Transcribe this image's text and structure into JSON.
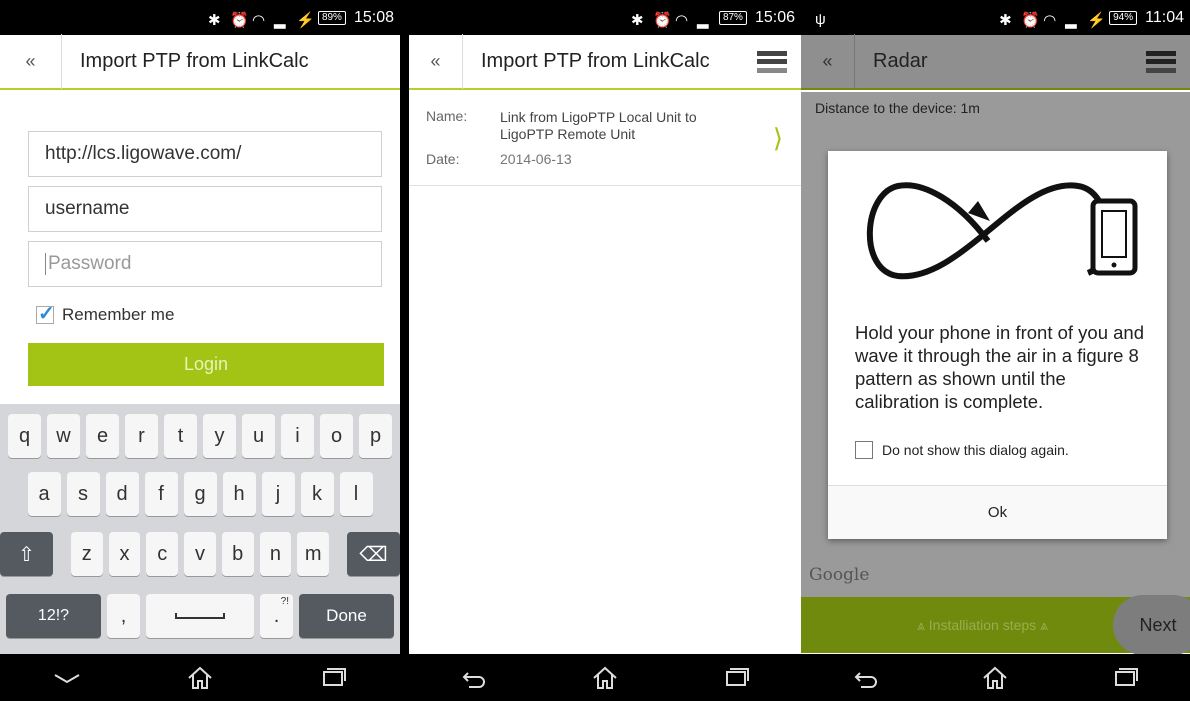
{
  "colors": {
    "accent": "#a3c415",
    "dim_green": "#6f8a0c"
  },
  "panel1": {
    "status": {
      "battery": "89%",
      "time": "15:08"
    },
    "title": "Import PTP from LinkCalc",
    "back_icon": "double-chevron-left-icon",
    "url_value": "http://lcs.ligowave.com/",
    "username_value": "username",
    "password_placeholder": "Password",
    "remember_label": "Remember me",
    "remember_checked": true,
    "login_label": "Login",
    "keyboard": {
      "row1": [
        "q",
        "w",
        "e",
        "r",
        "t",
        "y",
        "u",
        "i",
        "o",
        "p"
      ],
      "row2": [
        "a",
        "s",
        "d",
        "f",
        "g",
        "h",
        "j",
        "k",
        "l"
      ],
      "row3": [
        "z",
        "x",
        "c",
        "v",
        "b",
        "n",
        "m"
      ],
      "shift": "⇧",
      "backspace": "⌫",
      "symbols": "12!?",
      "comma": ",",
      "period": ".",
      "period_alt": "?!",
      "done": "Done"
    }
  },
  "panel2": {
    "status": {
      "battery": "87%",
      "time": "15:06"
    },
    "title": "Import PTP from LinkCalc",
    "name_label": "Name:",
    "name_value": "Link from LigoPTP Local Unit to LigoPTP Remote Unit",
    "date_label": "Date:",
    "date_value": "2014-06-13",
    "chevron": "⟩"
  },
  "panel3": {
    "status": {
      "battery": "94%",
      "time": "11:04"
    },
    "title": "Radar",
    "distance": "Distance to the device: 1m",
    "dialog_text": "Hold your phone in front of you and wave it through the air in a figure 8 pattern as shown until the calibration is complete.",
    "dont_show_label": "Do not show this dialog again.",
    "ok_label": "Ok",
    "map_watermark": "Google",
    "steps_label": "⩓ Installiation steps ⩓",
    "next_label": "Next"
  }
}
